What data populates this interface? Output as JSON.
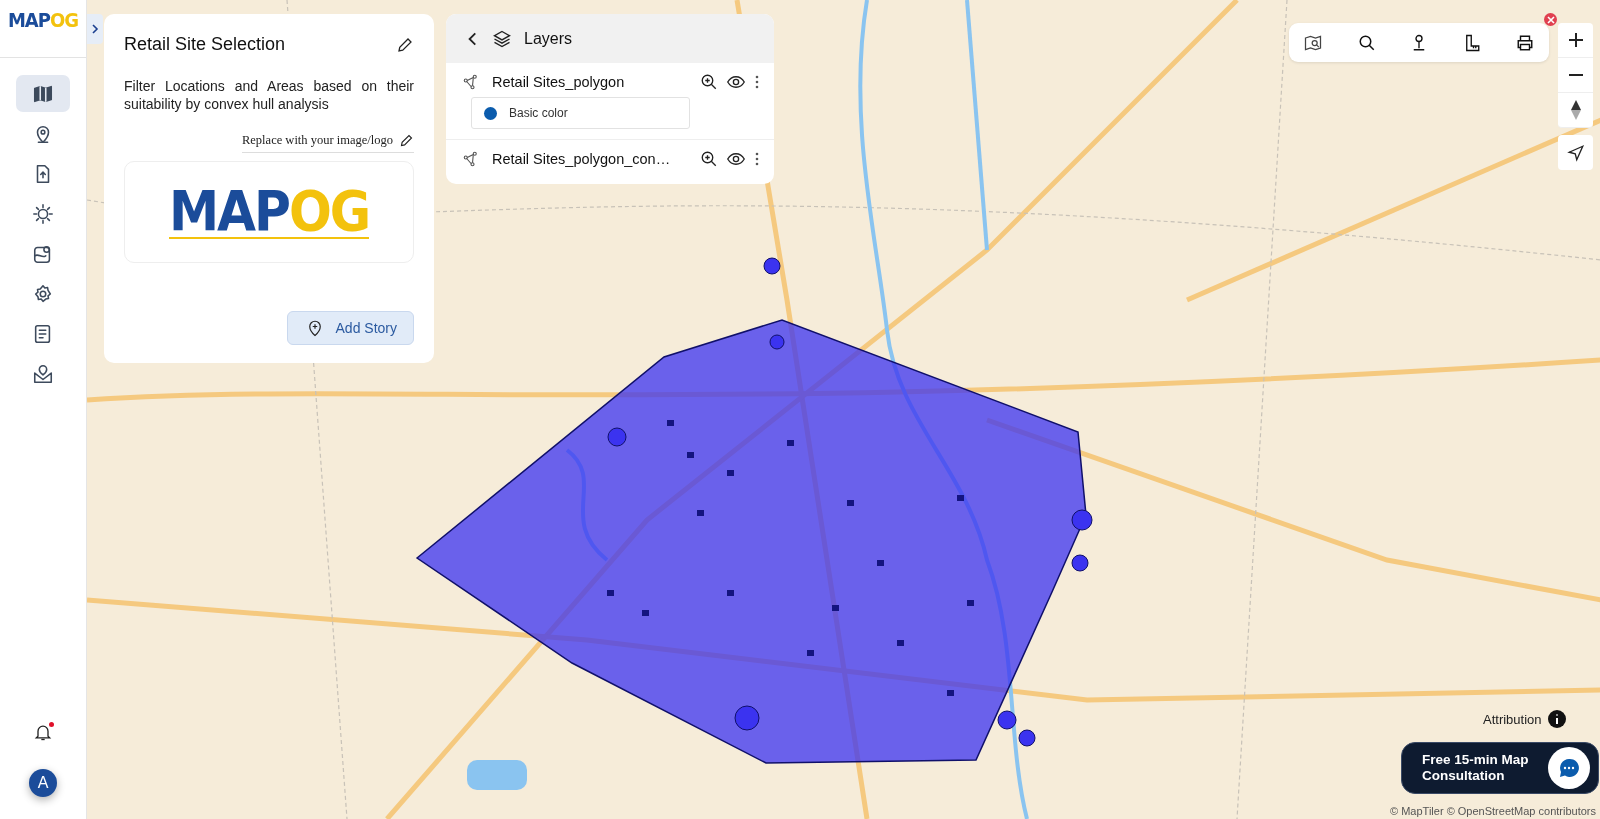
{
  "brand": {
    "logo_main": "MAP",
    "logo_accent": "OG"
  },
  "sidebar": {
    "items": [
      {
        "selected": true
      },
      {
        "selected": false
      },
      {
        "selected": false
      },
      {
        "selected": false
      },
      {
        "selected": false
      },
      {
        "selected": false
      },
      {
        "selected": false
      },
      {
        "selected": false
      }
    ],
    "notification": {
      "unread": true
    },
    "avatar": "A"
  },
  "story_panel": {
    "title": "Retail Site Selection",
    "description": "Filter Locations and Areas based on their suitability by convex hull analysis",
    "replace_label": "Replace with your image/logo",
    "logo_main": "MAP",
    "logo_accent": "OG",
    "add_button": "Add Story"
  },
  "layers_panel": {
    "title": "Layers",
    "layers": [
      {
        "name": "Retail Sites_polygon",
        "style": {
          "label": "Basic color",
          "color": "#0b5cad"
        }
      },
      {
        "name": "Retail Sites_polygon_con…"
      }
    ]
  },
  "map": {
    "attribution_label": "Attribution",
    "copyright": "© MapTiler © OpenStreetMap contributors"
  },
  "consult_button": "Free 15-min Map Consultation"
}
